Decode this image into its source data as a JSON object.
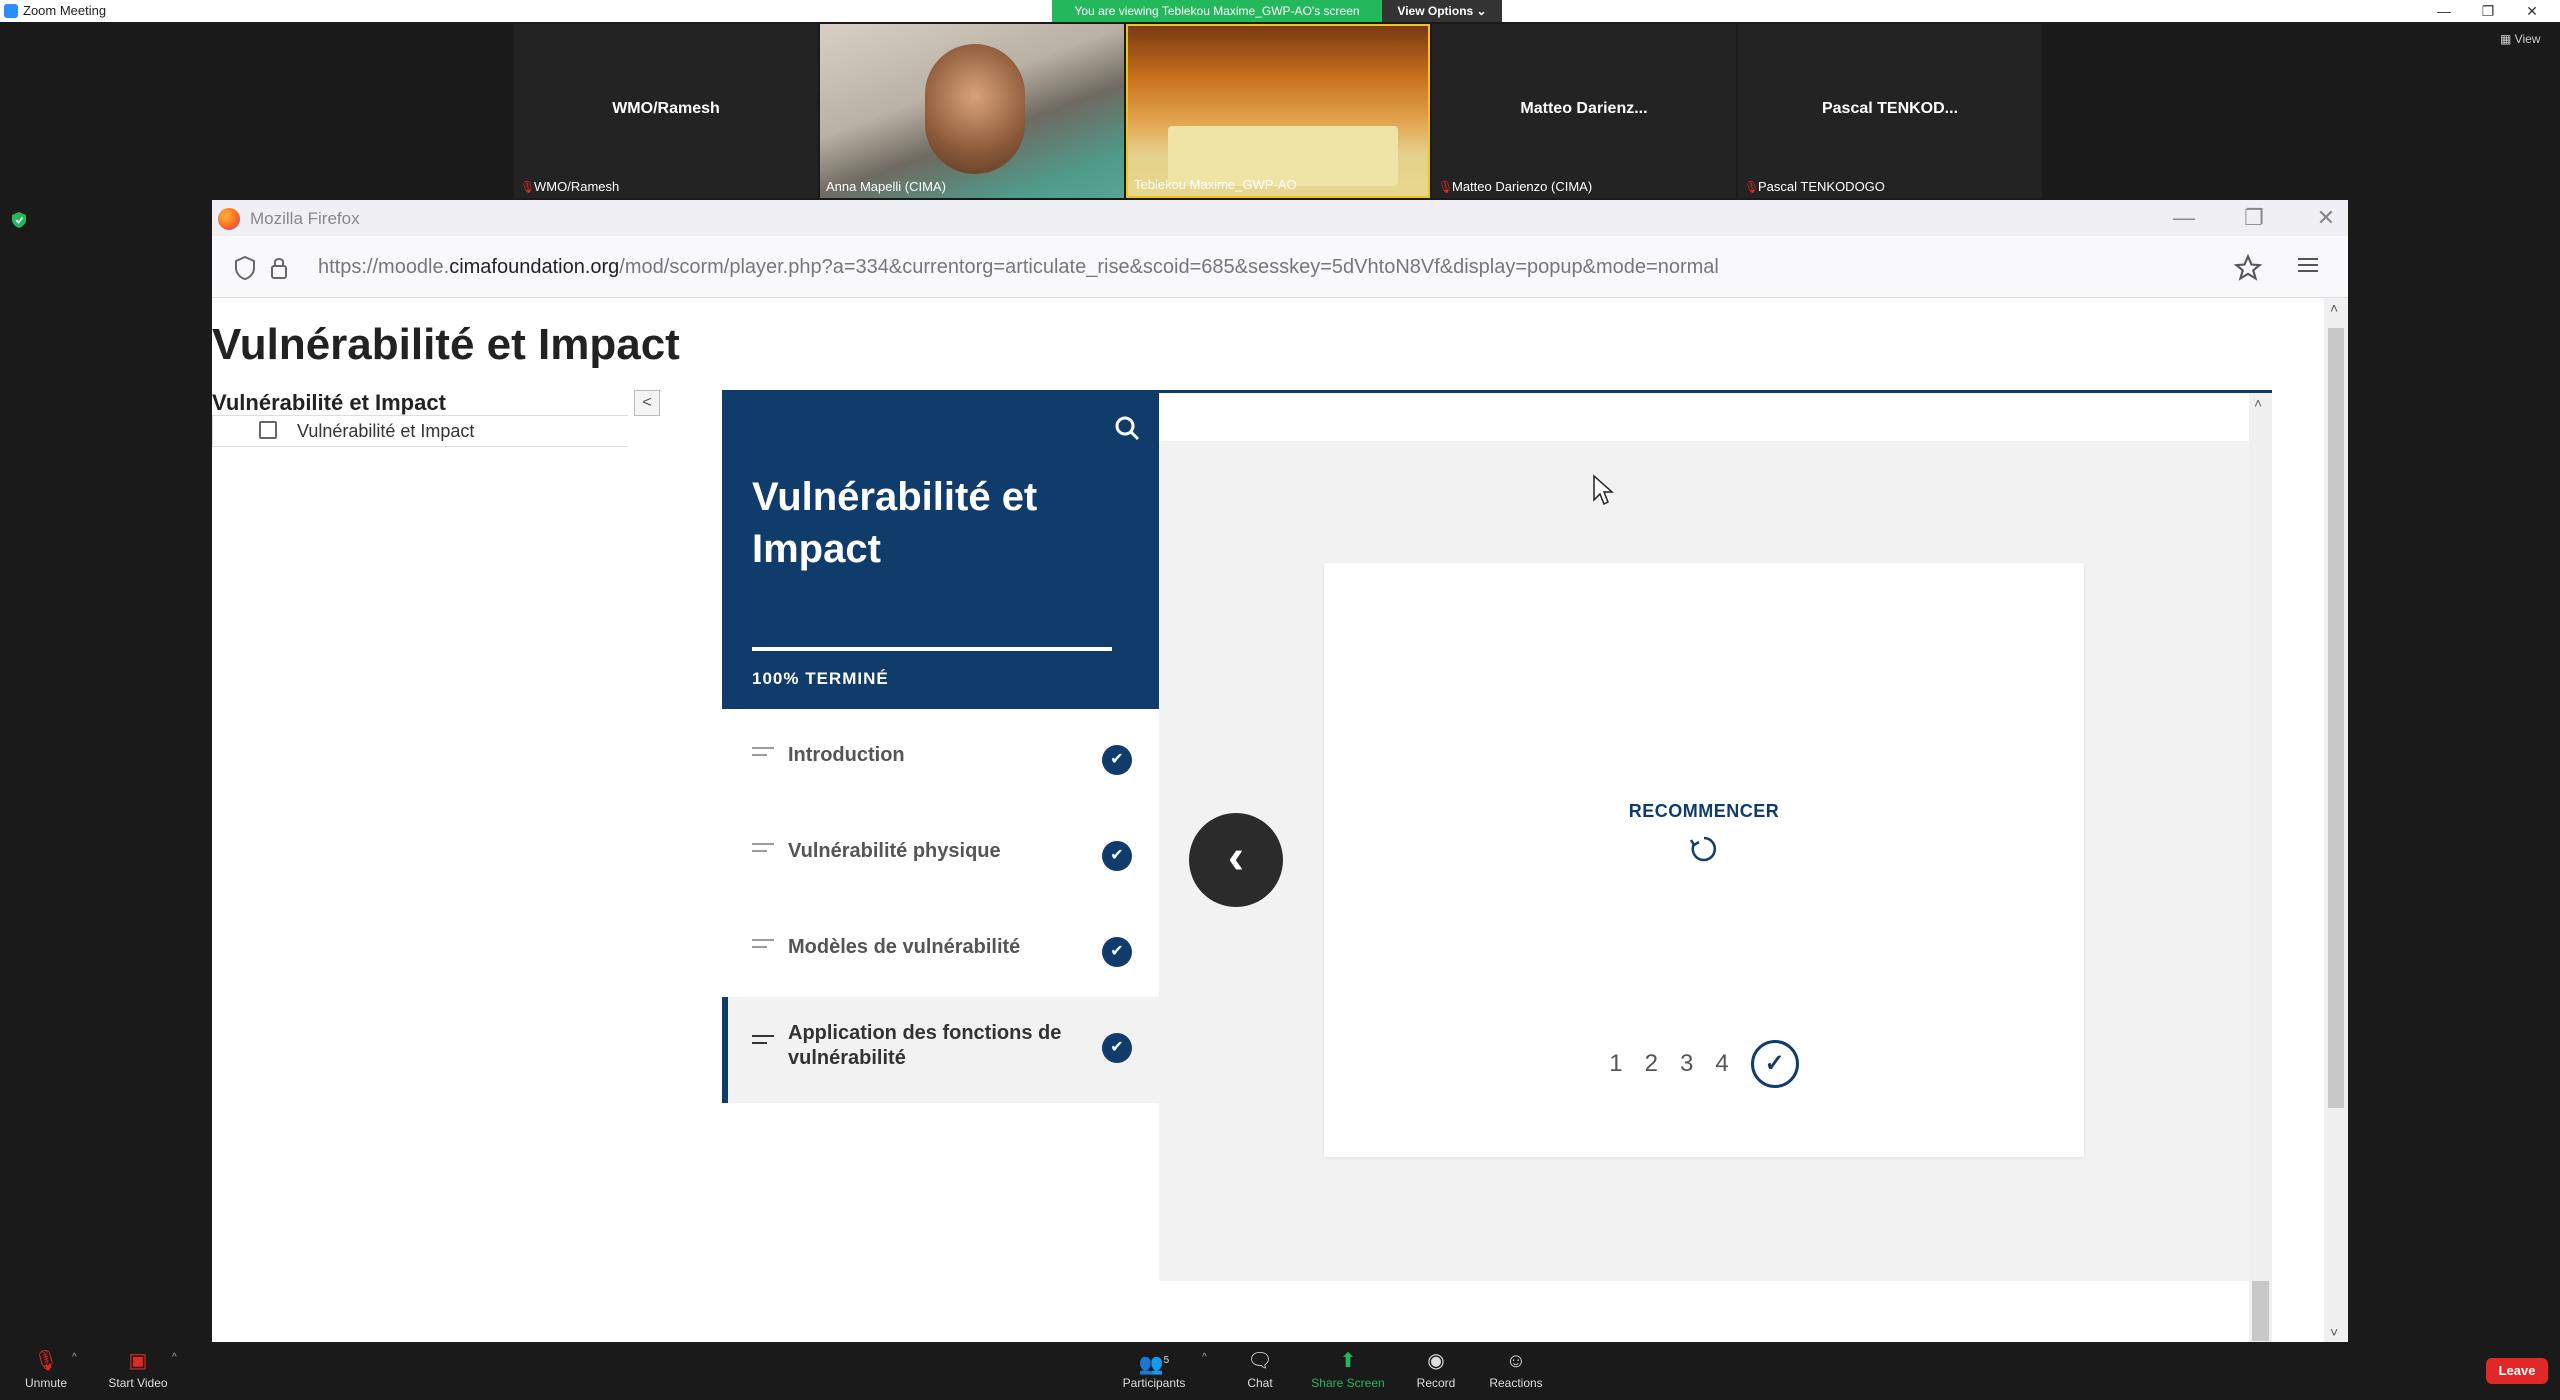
{
  "zoom": {
    "window_title": "Zoom Meeting",
    "viewing_banner": "You are viewing Teblekou Maxime_GWP-AO's screen",
    "view_options": "View Options ⌄",
    "view_label": "View",
    "participants": [
      {
        "name": "WMO/Ramesh",
        "label": "WMO/Ramesh"
      },
      {
        "name": "",
        "label": "Anna Mapelli (CIMA)"
      },
      {
        "name": "",
        "label": "Teblekou Maxime_GWP-AO"
      },
      {
        "name": "Matteo  Darienz...",
        "label": "Matteo Darienzo (CIMA)"
      },
      {
        "name": "Pascal  TENKOD...",
        "label": "Pascal TENKODOGO"
      }
    ],
    "toolbar": {
      "unmute": "Unmute",
      "start_video": "Start Video",
      "participants": "Participants",
      "participants_count": "5",
      "chat": "Chat",
      "share_screen": "Share Screen",
      "record": "Record",
      "reactions": "Reactions",
      "leave": "Leave"
    }
  },
  "firefox": {
    "title": "Mozilla Firefox",
    "url_prefix": "https://moodle.",
    "url_domain": "cimafoundation.org",
    "url_rest": "/mod/scorm/player.php?a=334&currentorg=articulate_rise&scoid=685&sesskey=5dVhtoN8Vf&display=popup&mode=normal"
  },
  "page": {
    "title": "Vulnérabilité et Impact",
    "toc_title": "Vulnérabilité et Impact",
    "toc_collapse": "<",
    "toc_item": "Vulnérabilité et Impact"
  },
  "rise": {
    "course_title": "Vulnérabilité et Impact",
    "progress_text": "100% TERMINÉ",
    "progress_value": 1.0,
    "lessons": [
      {
        "label": "Introduction",
        "done": true
      },
      {
        "label": "Vulnérabilité physique",
        "done": true
      },
      {
        "label": "Modèles de vulnérabilité",
        "done": true
      },
      {
        "label": "Application des fonctions de vulnérabilité",
        "done": true
      }
    ],
    "restart_label": "RECOMMENCER",
    "pages": [
      "1",
      "2",
      "3",
      "4"
    ],
    "accent_color": "#0f3c6b"
  }
}
